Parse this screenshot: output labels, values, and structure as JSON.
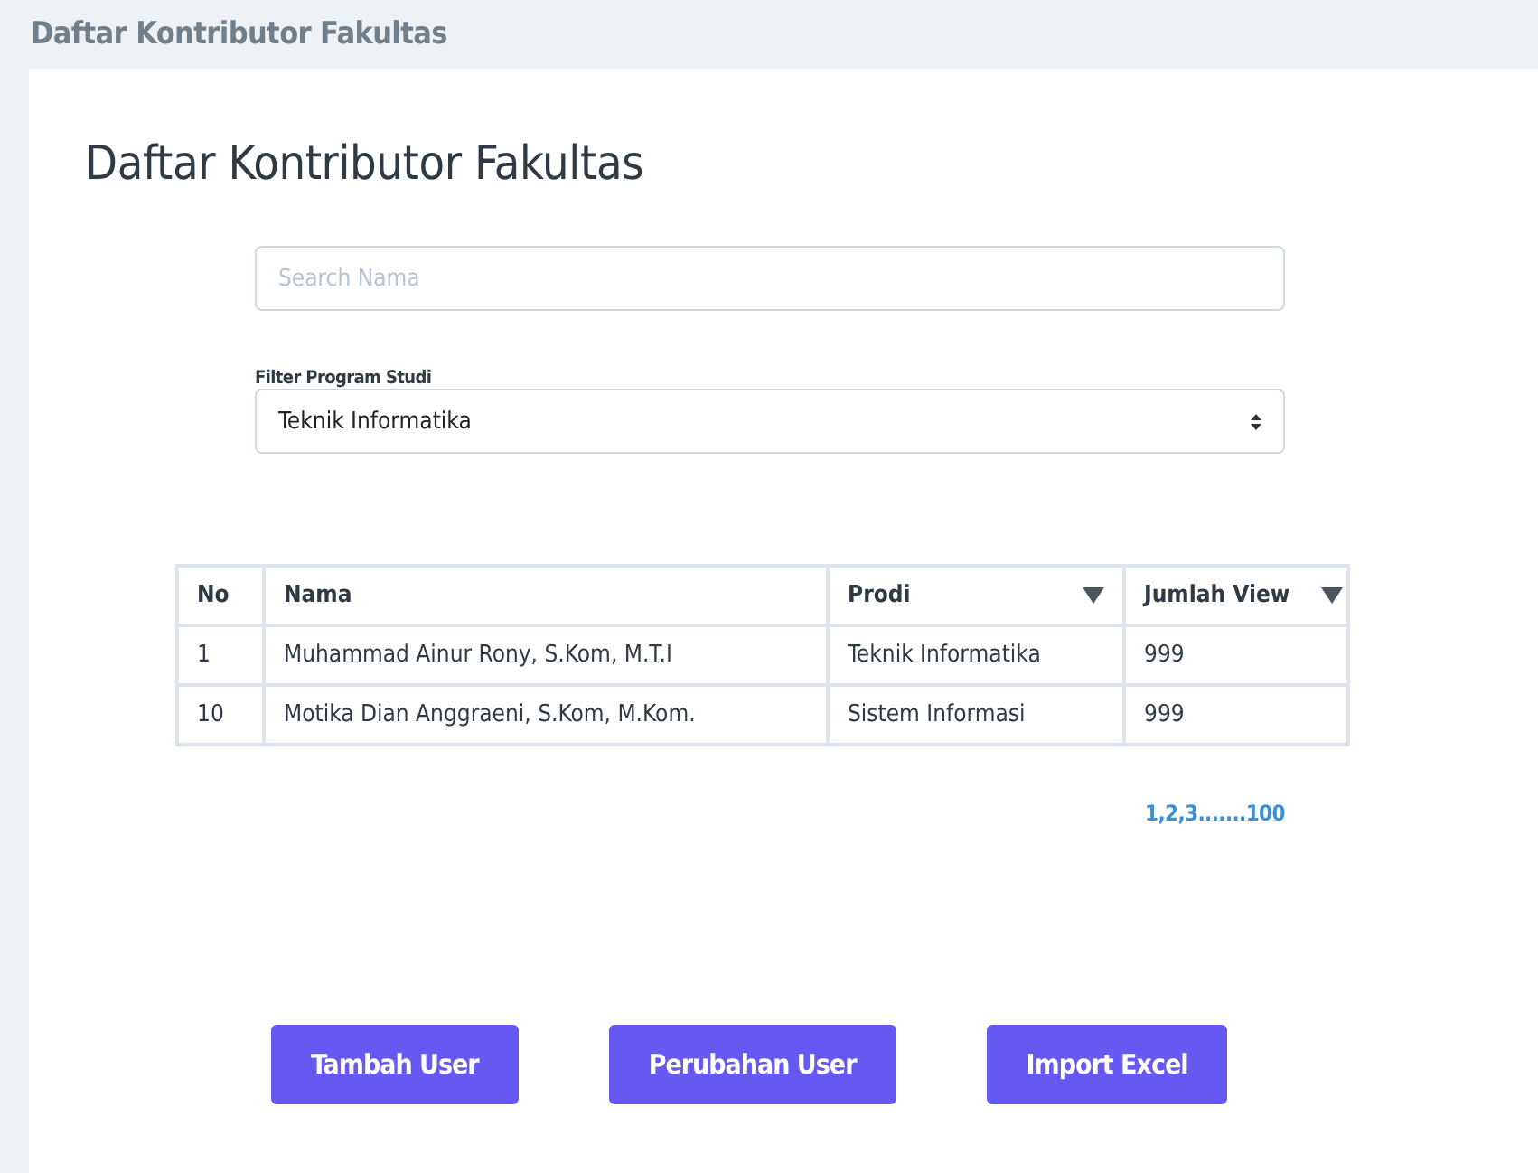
{
  "page_header": {
    "title": "Daftar Kontributor Fakultas"
  },
  "heading": "Daftar Kontributor Fakultas",
  "search": {
    "placeholder": "Search Nama"
  },
  "filter": {
    "label": "Filter Program Studi",
    "value": "Teknik Informatika"
  },
  "table": {
    "columns": [
      {
        "label": "No",
        "sortable": false
      },
      {
        "label": "Nama",
        "sortable": false
      },
      {
        "label": "Prodi",
        "sortable": true
      },
      {
        "label": "Jumlah View",
        "sortable": true
      }
    ],
    "rows": [
      [
        "1",
        "Muhammad Ainur Rony, S.Kom, M.T.I",
        "Teknik Informatika",
        "999"
      ],
      [
        "10",
        "Motika Dian Anggraeni, S.Kom, M.Kom.",
        "Sistem Informasi",
        "999"
      ]
    ]
  },
  "pagination": "1,2,3.......100",
  "buttons": [
    "Tambah User",
    "Perubahan User",
    "Import Excel"
  ]
}
